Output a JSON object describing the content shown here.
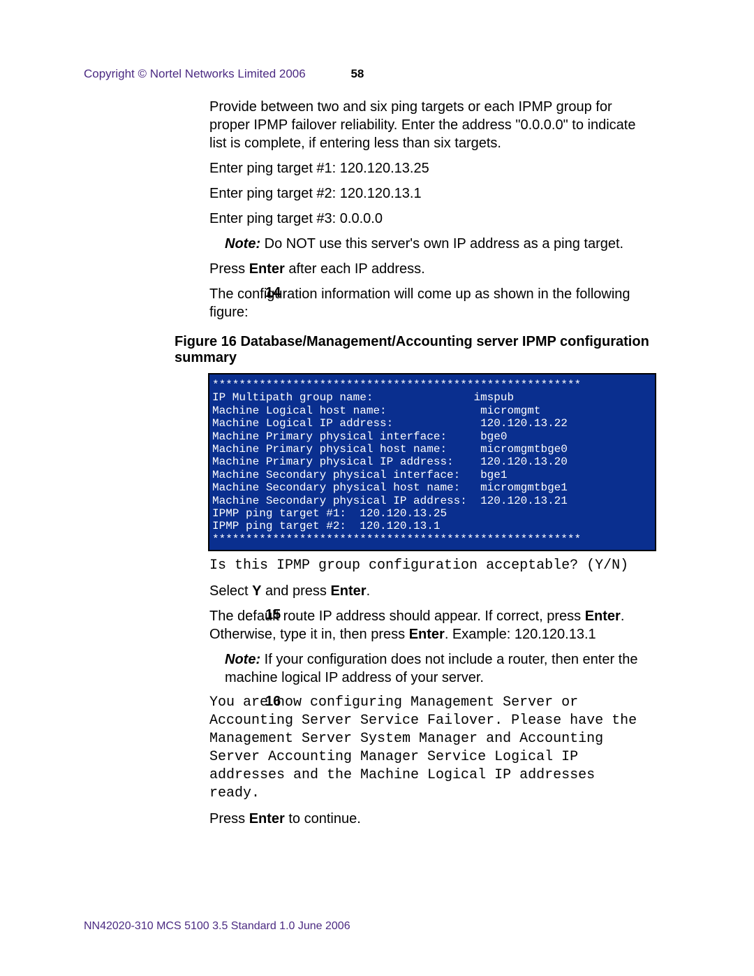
{
  "header": {
    "copyright": "Copyright © Nortel Networks Limited 2006",
    "pageNumber": "58"
  },
  "intro": {
    "p1": "Provide between two and six ping targets or each IPMP group for proper IPMP failover reliability. Enter the address \"0.0.0.0\" to indicate list is complete, if entering less than six targets.",
    "t1": "Enter ping target #1: 120.120.13.25",
    "t2": "Enter ping target #2: 120.120.13.1",
    "t3": "Enter ping target #3: 0.0.0.0",
    "note_label": "Note:",
    "note_body": "  Do NOT use this server's own IP address as a ping target.",
    "press_pre": "Press ",
    "press_bold": "Enter",
    "press_post": " after each IP address."
  },
  "step14": {
    "num": "14",
    "text": "The configuration information will come up as shown in the following figure:"
  },
  "figure": {
    "title": "Figure 16  Database/Management/Accounting server  IPMP configuration summary",
    "terminal": "*******************************************************\nIP Multipath group name:               imspub\nMachine Logical host name:              micromgmt\nMachine Logical IP address:             120.120.13.22\nMachine Primary physical interface:     bge0\nMachine Primary physical host name:     micromgmtbge0\nMachine Primary physical IP address:    120.120.13.20\nMachine Secondary physical interface:   bge1\nMachine Secondary physical host name:   micromgmtbge1\nMachine Secondary physical IP address:  120.120.13.21\nIPMP ping target #1:  120.120.13.25\nIPMP ping target #2:  120.120.13.1\n*******************************************************"
  },
  "after_fig": {
    "q1": "Is this IPMP group configuration acceptable? (Y/N)",
    "sel_pre": "Select ",
    "sel_y": "Y",
    "sel_mid": " and press ",
    "sel_enter": "Enter",
    "sel_post": "."
  },
  "step15": {
    "num": "15",
    "l1_pre": "The default route IP address should appear. If correct, press ",
    "l1_b1": "Enter",
    "l1_mid": ". Otherwise, type it in, then press ",
    "l1_b2": "Enter",
    "l1_post": ".  Example: 120.120.13.1",
    "note_label": "Note:",
    "note_body": "  If your configuration does not include a router, then enter the machine logical IP address of your server."
  },
  "step16": {
    "num": "16",
    "body": "You are now configuring Management Server or Accounting Server Service Failover. Please have the Management Server System Manager and Accounting Server Accounting Manager Service Logical IP addresses and the Machine Logical IP addresses ready.",
    "press_pre": "Press ",
    "press_bold": "Enter",
    "press_post": " to continue."
  },
  "footer": {
    "text": "NN42020-310   MCS 5100 3.5   Standard   1.0   June 2006"
  }
}
